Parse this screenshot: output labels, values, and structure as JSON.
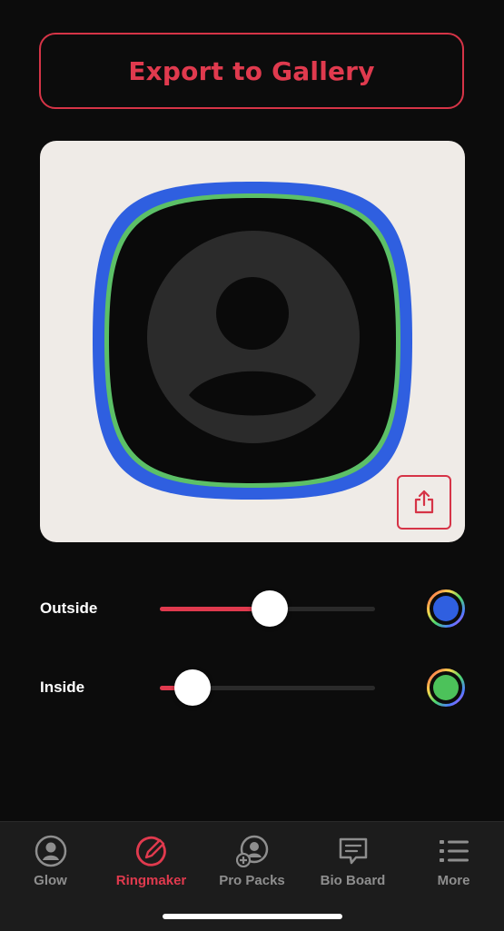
{
  "export_button": {
    "label": "Export to Gallery"
  },
  "sliders": [
    {
      "label": "Outside",
      "value_fraction": 0.51,
      "color": "#2f5fe0"
    },
    {
      "label": "Inside",
      "value_fraction": 0.15,
      "color": "#4cc25a"
    }
  ],
  "colors": {
    "accent": "#e03a4e",
    "outer_ring": "#2f5fe0",
    "inner_ring": "#5cc067",
    "preview_bg": "#efebe7"
  },
  "tabs": [
    {
      "label": "Glow",
      "icon": "person-circle-icon",
      "active": false
    },
    {
      "label": "Ringmaker",
      "icon": "ring-pencil-icon",
      "active": true
    },
    {
      "label": "Pro Packs",
      "icon": "person-plus-icon",
      "active": false
    },
    {
      "label": "Bio Board",
      "icon": "speech-bubble-icon",
      "active": false
    },
    {
      "label": "More",
      "icon": "list-icon",
      "active": false
    }
  ]
}
